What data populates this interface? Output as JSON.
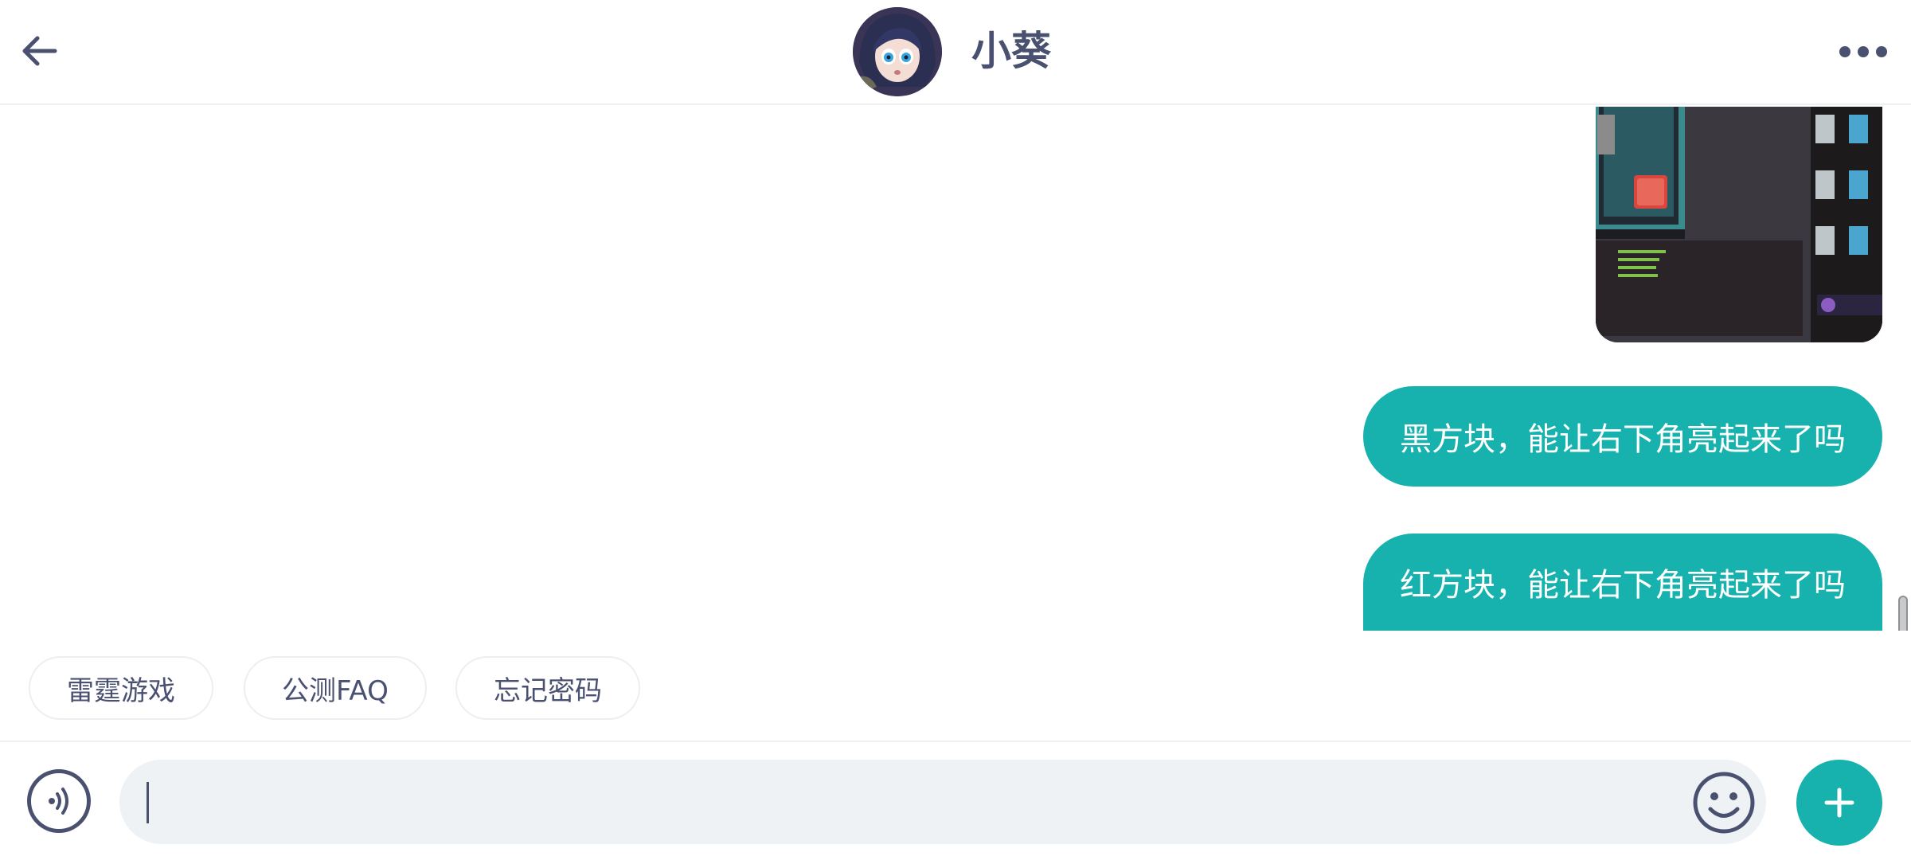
{
  "header": {
    "title": "小葵",
    "back_icon": "arrow-left-icon",
    "more_icon": "more-horizontal-icon"
  },
  "messages": [
    {
      "type": "image",
      "sender": "me",
      "content": "game screenshot"
    },
    {
      "type": "text",
      "sender": "me",
      "text": "黑方块，能让右下角亮起来了吗"
    },
    {
      "type": "text",
      "sender": "me",
      "text": "红方块，能让右下角亮起来了吗"
    }
  ],
  "quick_replies": [
    "雷霆游戏",
    "公测FAQ",
    "忘记密码"
  ],
  "composer": {
    "value": "",
    "voice_icon": "voice-icon",
    "emoji_icon": "emoji-icon",
    "plus_icon": "plus-icon"
  },
  "colors": {
    "accent": "#17b2ad",
    "text": "#4a5170",
    "input_bg": "#eff2f5"
  }
}
